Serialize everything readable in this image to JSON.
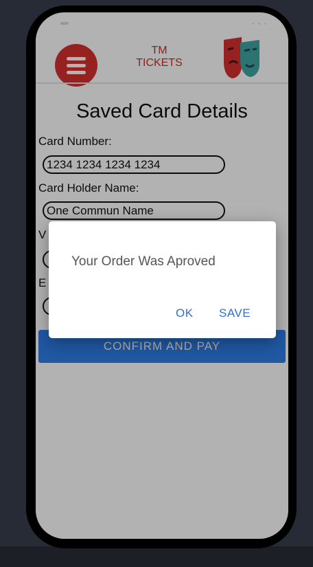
{
  "app": {
    "brand_line1": "TM",
    "brand_line2": "TICKETS"
  },
  "page": {
    "title": "Saved Card Details"
  },
  "form": {
    "card_number_label": "Card Number:",
    "card_number_value": "1234 1234 1234 1234",
    "card_holder_label": "Card Holder Name:",
    "card_holder_value": "One Commun Name",
    "validity_label_partial": "V",
    "expiry_label_partial": "E",
    "confirm_button": "CONFIRM AND PAY"
  },
  "dialog": {
    "message": "Your Order Was Aproved",
    "ok_label": "OK",
    "save_label": "SAVE"
  },
  "colors": {
    "brand_red": "#d6322e",
    "primary_blue": "#2f7fea",
    "dialog_button_blue": "#2f6fd6",
    "background": "#262b35"
  },
  "icons": {
    "menu": "hamburger-menu-icon",
    "logo": "theater-mask-icon"
  }
}
